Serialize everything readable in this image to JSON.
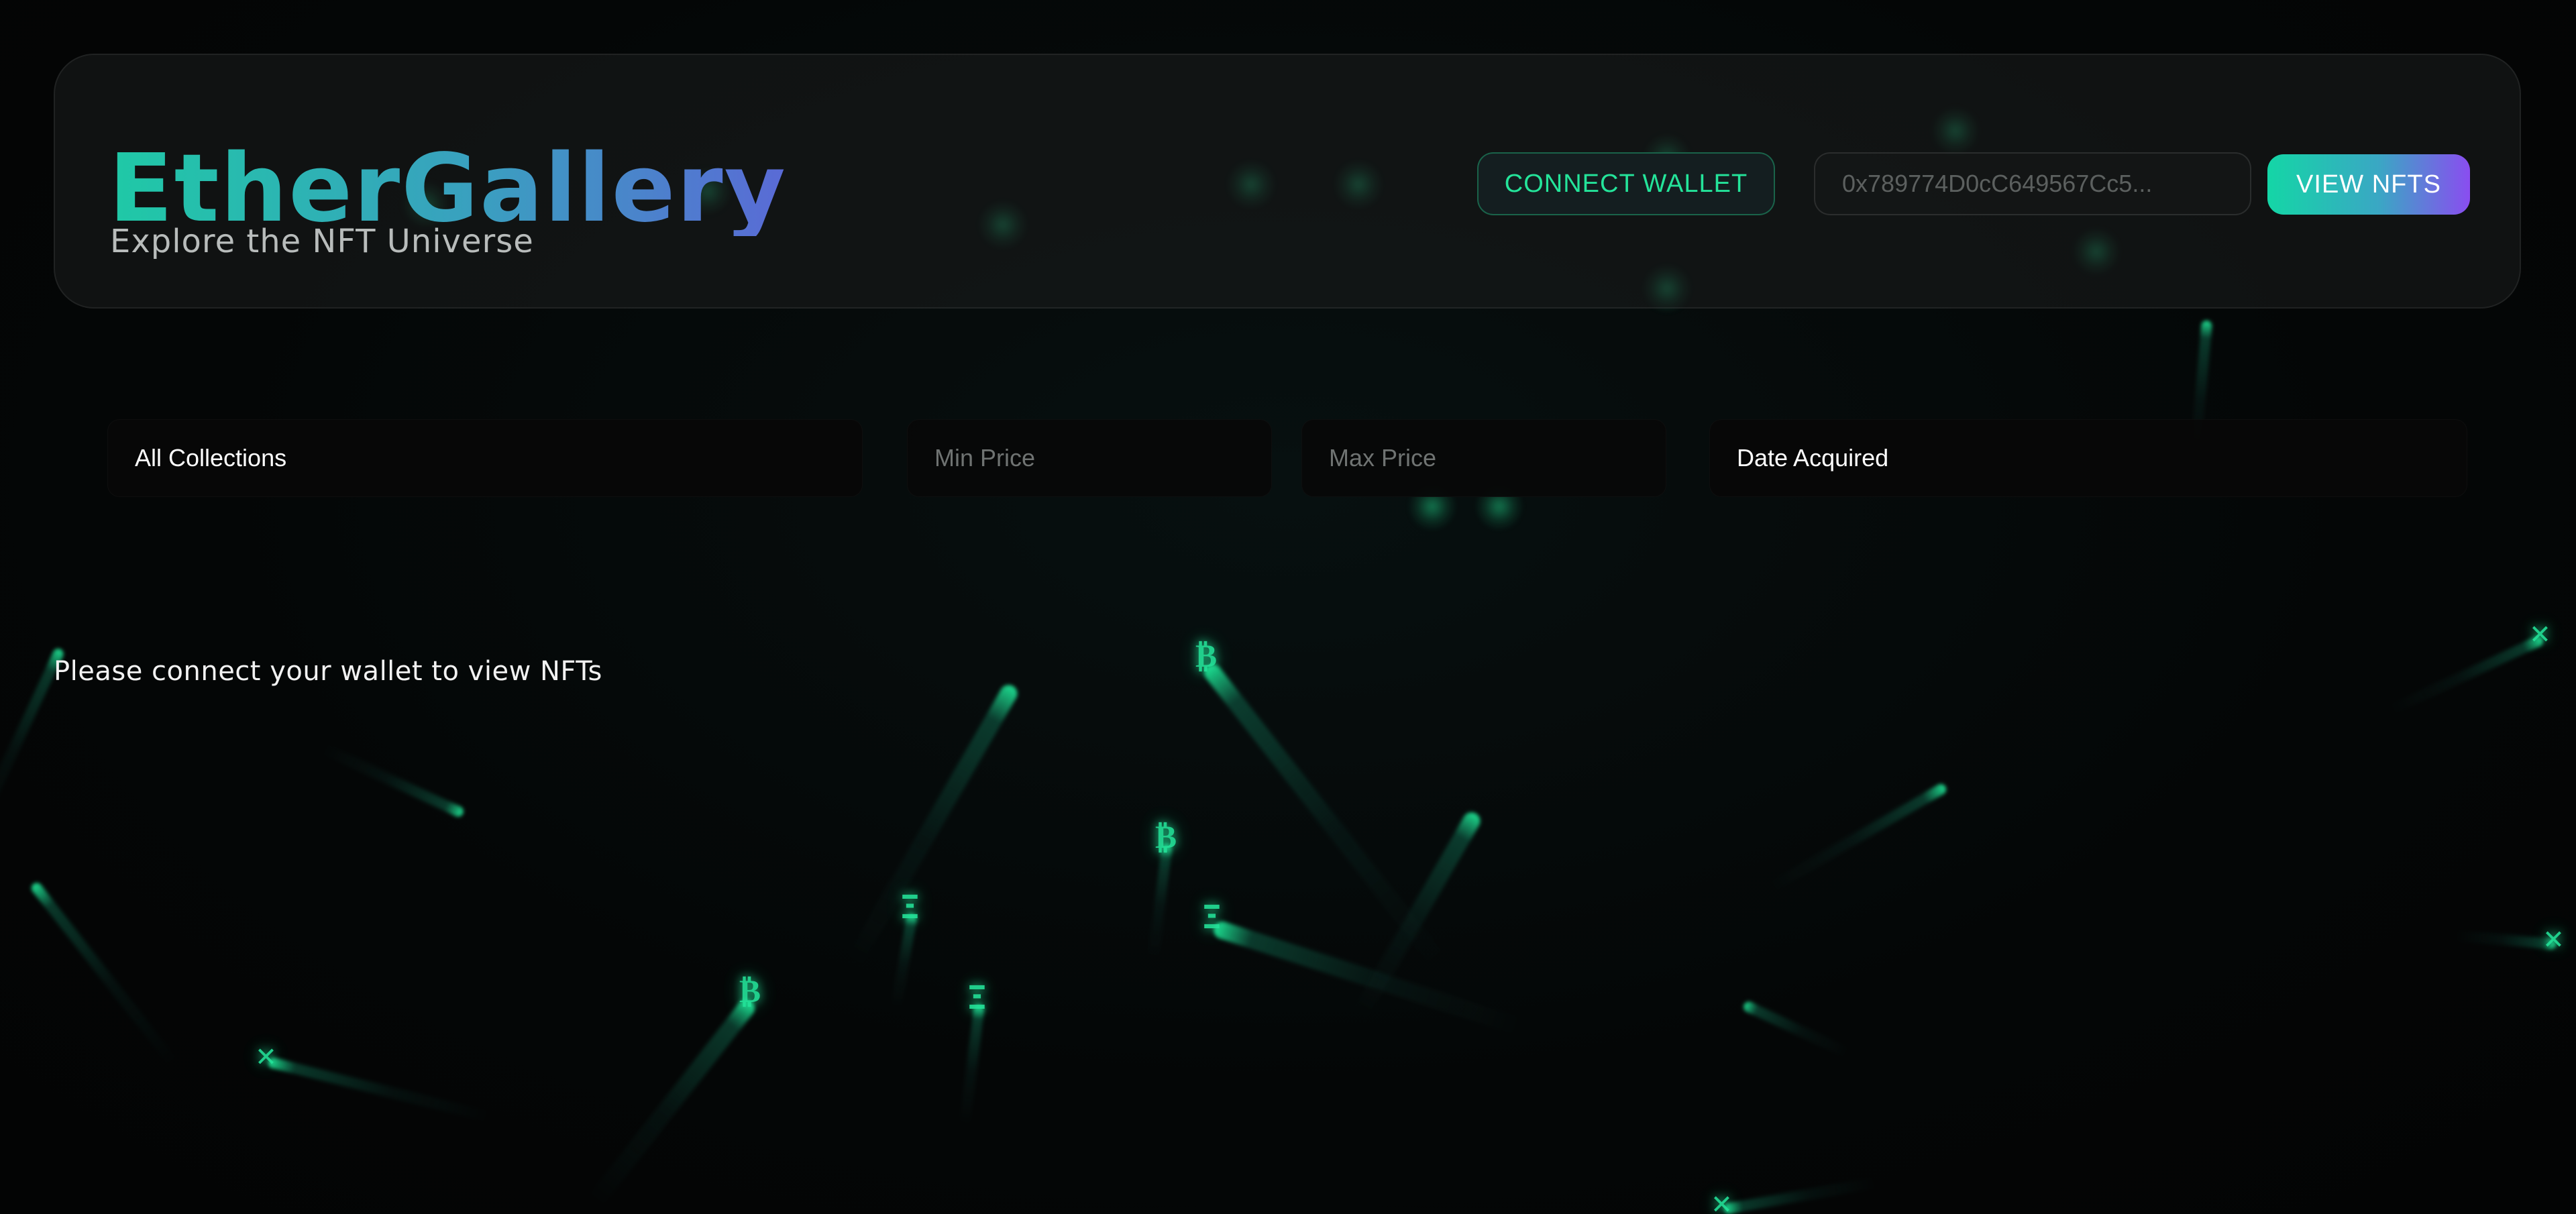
{
  "header": {
    "title": "EtherGallery",
    "subtitle": "Explore the NFT Universe",
    "connect_wallet_label": "CONNECT WALLET",
    "address_placeholder": "0x789774D0cC649567Cc5...",
    "view_nfts_label": "VIEW NFTS"
  },
  "filters": {
    "collection_selected": "All Collections",
    "min_price_placeholder": "Min Price",
    "max_price_placeholder": "Max Price",
    "sort_selected": "Date Acquired"
  },
  "main": {
    "empty_message": "Please connect your wallet to view NFTs"
  },
  "background": {
    "glyphs": [
      "Ξ",
      "₿",
      "✕"
    ]
  },
  "colors": {
    "accent_green": "#24e49a",
    "gradient_start": "#1fc9a6",
    "gradient_end": "#5a6ad6",
    "button_gradient_end": "#8a4df0",
    "background": "#040606"
  }
}
